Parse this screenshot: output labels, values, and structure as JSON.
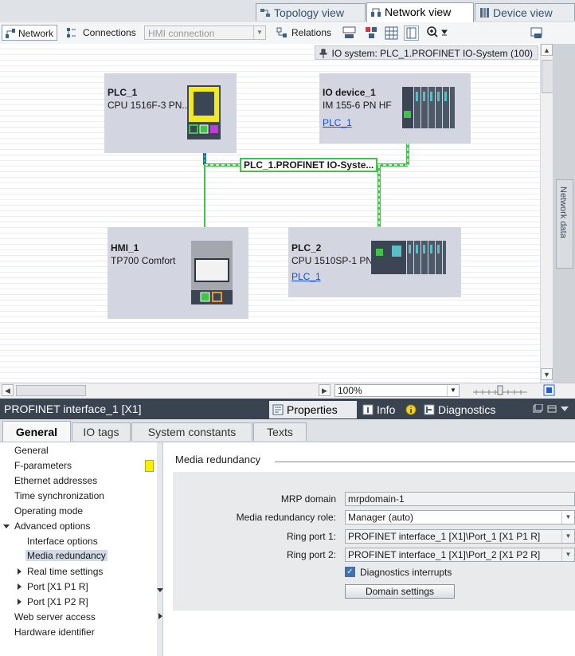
{
  "view_tabs": [
    {
      "label": "Topology view",
      "active": false
    },
    {
      "label": "Network view",
      "active": true
    },
    {
      "label": "Device view",
      "active": false
    }
  ],
  "toolbar": {
    "network_label": "Network",
    "connections_label": "Connections",
    "connection_type": "HMI connection",
    "relations_label": "Relations"
  },
  "io_system_label": "IO system: PLC_1.PROFINET IO-System (100)",
  "devices": {
    "plc1": {
      "name": "PLC_1",
      "type": "CPU 1516F-3 PN..."
    },
    "iodevice1": {
      "name": "IO device_1",
      "type": "IM 155-6 PN HF",
      "link": "PLC_1"
    },
    "hmi1": {
      "name": "HMI_1",
      "type": "TP700 Comfort"
    },
    "plc2": {
      "name": "PLC_2",
      "type": "CPU 1510SP-1 PN",
      "link": "PLC_1"
    }
  },
  "network_label": "PLC_1.PROFINET IO-Syste...",
  "side_panel_label": "Network data",
  "zoom": "100%",
  "properties": {
    "title": "PROFINET interface_1 [X1]",
    "tabs": [
      {
        "label": "Properties",
        "active": true
      },
      {
        "label": "Info",
        "active": false
      },
      {
        "label": "Diagnostics",
        "active": false
      }
    ]
  },
  "sub_tabs": [
    "General",
    "IO tags",
    "System constants",
    "Texts"
  ],
  "tree": [
    "General",
    "F-parameters",
    "Ethernet addresses",
    "Time synchronization",
    "Operating mode",
    "Advanced options",
    "Interface options",
    "Media redundancy",
    "Real time settings",
    "Port [X1 P1 R]",
    "Port [X1 P2 R]",
    "Web server access",
    "Hardware identifier"
  ],
  "section": {
    "title": "Media redundancy",
    "mrp_domain_label": "MRP domain",
    "mrp_domain_value": "mrpdomain-1",
    "role_label": "Media redundancy role:",
    "role_value": "Manager (auto)",
    "ring1_label": "Ring port 1:",
    "ring1_value": "PROFINET interface_1 [X1]\\Port_1 [X1 P1 R]",
    "ring2_label": "Ring port 2:",
    "ring2_value": "PROFINET interface_1 [X1]\\Port_2 [X1 P2 R]",
    "diag_label": "Diagnostics interrupts",
    "diag_checked": true,
    "domain_button": "Domain settings"
  },
  "colors": {
    "profinet_line": "#3fc447",
    "header_bg": "#3a4350",
    "device_bg": "#d3d6e1",
    "plc_yellow": "#f3ea1b"
  }
}
